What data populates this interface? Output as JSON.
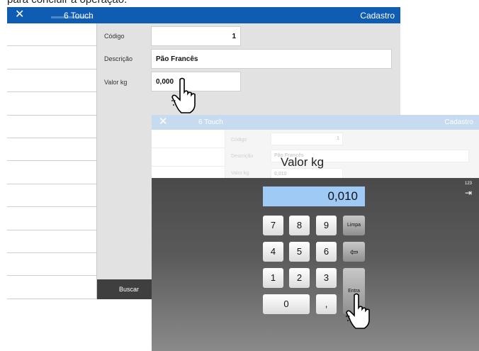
{
  "caption": "para concluir a operação.",
  "back_window": {
    "close_glyph": "✕",
    "title": "6 Touch",
    "right_label": "Cadastro",
    "codigo_label": "Código",
    "codigo_value": "1",
    "descricao_label": "Descrição",
    "descricao_value": "Pão Francês",
    "valor_label": "Valor kg",
    "valor_value": "0,000",
    "buscar_label": "Buscar"
  },
  "front_window": {
    "close_glyph": "✕",
    "title": "6 Touch",
    "right_label": "Cadastro",
    "faint_codigo_label": "Código",
    "faint_codigo_value": "1",
    "faint_descricao_label": "Descrição",
    "faint_descricao_value": "Pão Francês",
    "faint_valor_label": "Valor kg",
    "faint_valor_value": "0,010",
    "dialog_title": "Valor kg",
    "display_value": "0,010",
    "keys": {
      "k7": "7",
      "k8": "8",
      "k9": "9",
      "k4": "4",
      "k5": "5",
      "k6": "6",
      "k1": "1",
      "k2": "2",
      "k3": "3",
      "k0": "0",
      "comma": ","
    },
    "limpa_label": "Limpa",
    "backspace_glyph": "⇦",
    "entra_label": "Entra",
    "side_number": "123",
    "side_glyph": "⇥"
  },
  "icons": [
    "close-icon",
    "backspace-icon",
    "keyboard-toggle-icon",
    "hand-pointer-icon"
  ]
}
